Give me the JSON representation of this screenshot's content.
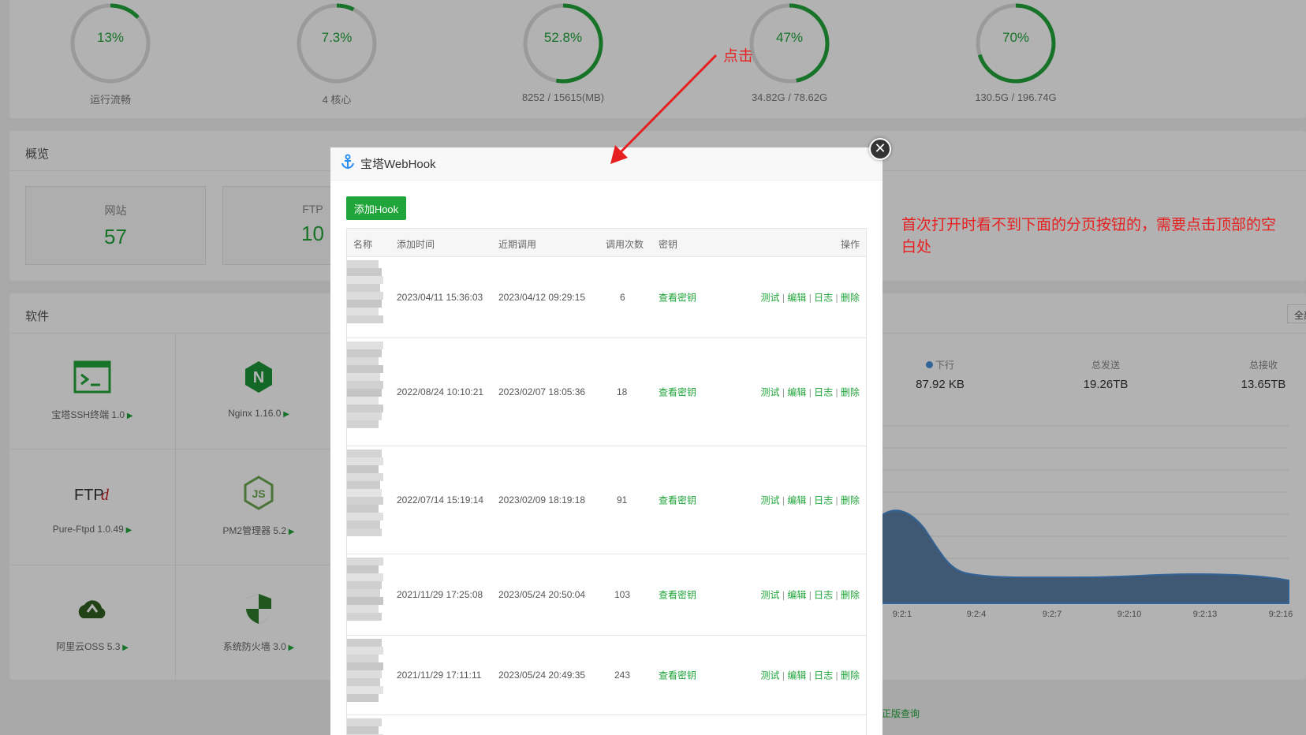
{
  "gauges": [
    {
      "pct": "13%",
      "label": "运行流畅",
      "frac": 0.13
    },
    {
      "pct": "7.3%",
      "label": "4 核心",
      "frac": 0.073
    },
    {
      "pct": "52.8%",
      "label": "8252 / 15615(MB)",
      "frac": 0.528
    },
    {
      "pct": "47%",
      "label": "34.82G / 78.62G",
      "frac": 0.47
    },
    {
      "pct": "70%",
      "label": "130.5G / 196.74G",
      "frac": 0.7
    }
  ],
  "overview": {
    "title": "概览",
    "stats": [
      {
        "label": "网站",
        "value": "57"
      },
      {
        "label": "FTP",
        "value": "10"
      }
    ]
  },
  "software": {
    "title": "软件",
    "all_button": "全部",
    "items": [
      {
        "name": "宝塔SSH终端 1.0",
        "icon": "terminal-icon"
      },
      {
        "name": "Nginx 1.16.0",
        "icon": "nginx-icon"
      },
      {
        "name": "Pure-Ftpd 1.0.49",
        "icon": "ftp-icon"
      },
      {
        "name": "PM2管理器 5.2",
        "icon": "nodejs-icon"
      },
      {
        "name": "阿里云OSS 5.3",
        "icon": "cloud-icon"
      },
      {
        "name": "系统防火墙 3.0",
        "icon": "shield-icon"
      }
    ]
  },
  "network": {
    "down_legend": "下行",
    "down_value": "87.92 KB",
    "total_sent_label": "总发送",
    "total_sent": "19.26TB",
    "total_recv_label": "总接收",
    "total_recv": "13.65TB",
    "x_ticks": [
      "9:2:1",
      "9:2:4",
      "9:2:7",
      "9:2:10",
      "9:2:13",
      "9:2:16"
    ]
  },
  "footer_link": "正版查询",
  "dialog": {
    "title": "宝塔WebHook",
    "add_button": "添加Hook",
    "columns": {
      "name": "名称",
      "added": "添加时间",
      "recent": "近期调用",
      "count": "调用次数",
      "key": "密钥",
      "ops": "操作"
    },
    "rows": [
      {
        "added": "2023/04/11 15:36:03",
        "recent": "2023/04/12 09:29:15",
        "count": "6",
        "key": "查看密钥"
      },
      {
        "added": "2022/08/24 10:10:21",
        "recent": "2023/02/07 18:05:36",
        "count": "18",
        "key": "查看密钥"
      },
      {
        "added": "2022/07/14 15:19:14",
        "recent": "2023/02/09 18:19:18",
        "count": "91",
        "key": "查看密钥"
      },
      {
        "added": "2021/11/29 17:25:08",
        "recent": "2023/05/24 20:50:04",
        "count": "103",
        "key": "查看密钥"
      },
      {
        "added": "2021/11/29 17:11:11",
        "recent": "2023/05/24 20:49:35",
        "count": "243",
        "key": "查看密钥"
      }
    ],
    "ops": {
      "test": "测试",
      "edit": "编辑",
      "log": "日志",
      "delete": "删除",
      "sep": "|"
    }
  },
  "annotations": {
    "click": "点击",
    "note": "首次打开时看不到下面的分页按钮的，需要点击顶部的空白处"
  },
  "colors": {
    "accent": "#20a53a",
    "annotation": "#e62020"
  }
}
